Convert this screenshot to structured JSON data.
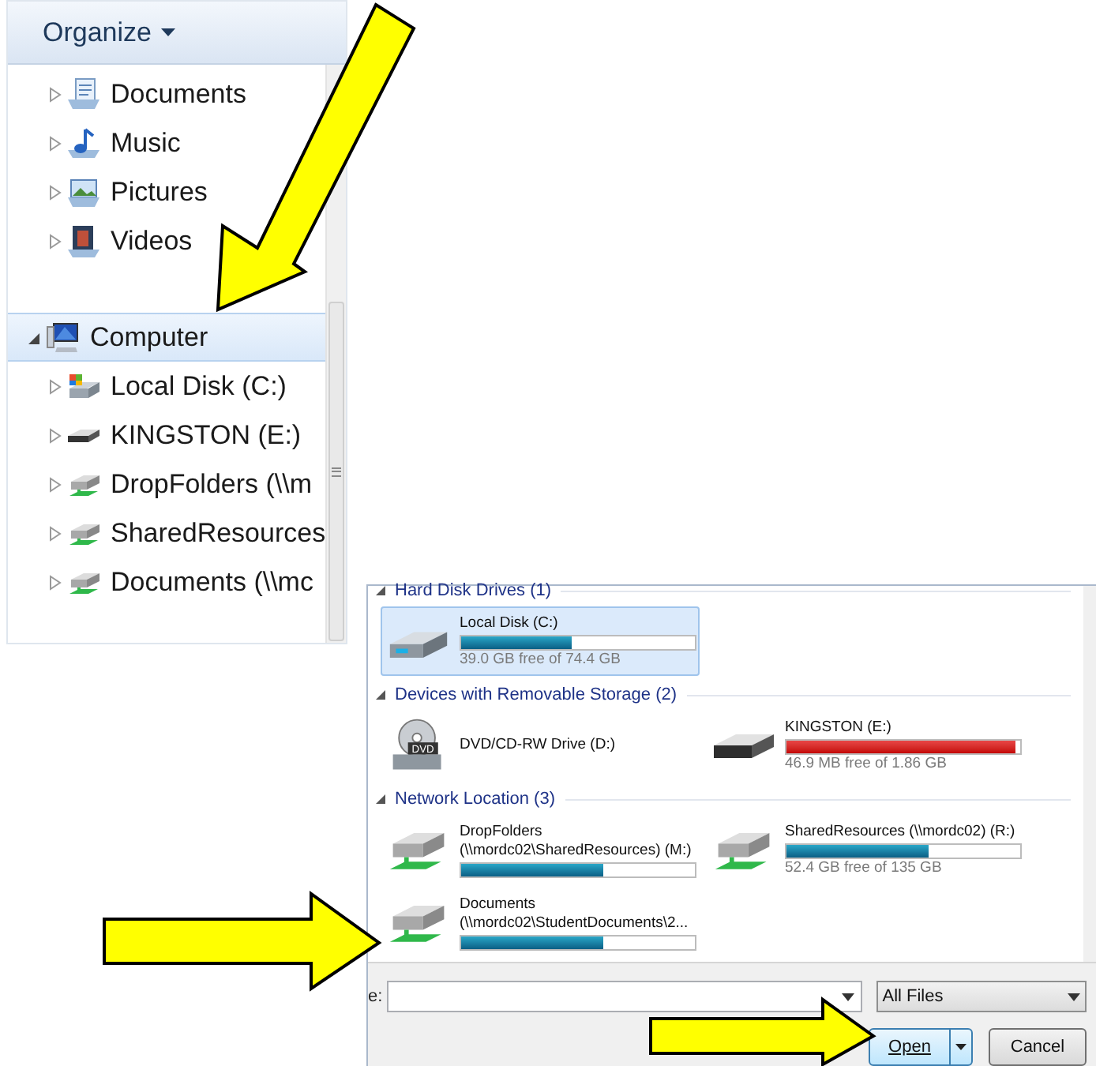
{
  "navigation_pane": {
    "organize_button": "Organize",
    "tree": [
      {
        "label": "Documents",
        "kind": "documents",
        "expanded": false,
        "selected": false
      },
      {
        "label": "Music",
        "kind": "music",
        "expanded": false,
        "selected": false
      },
      {
        "label": "Pictures",
        "kind": "pictures",
        "expanded": false,
        "selected": false
      },
      {
        "label": "Videos",
        "kind": "videos",
        "expanded": false,
        "selected": false
      },
      {
        "label": "Computer",
        "kind": "computer",
        "expanded": true,
        "selected": true,
        "children": [
          {
            "label": "Local Disk (C:)",
            "kind": "system-disk",
            "expanded": false,
            "selected": false
          },
          {
            "label": "KINGSTON (E:)",
            "kind": "usb",
            "expanded": false,
            "selected": false
          },
          {
            "label": "DropFolders (\\\\m",
            "kind": "network",
            "expanded": false,
            "selected": false
          },
          {
            "label": "SharedResources",
            "kind": "network",
            "expanded": false,
            "selected": false
          },
          {
            "label": "Documents (\\\\mc",
            "kind": "network",
            "expanded": false,
            "selected": false
          }
        ]
      }
    ]
  },
  "open_dialog": {
    "sections": [
      {
        "title": "Hard Disk Drives (1)",
        "expanded": true,
        "items": [
          {
            "kind": "hdd",
            "name": "Local Disk (C:)",
            "level": 0.47,
            "free": "39.0 GB free of 74.4 GB",
            "selected": true
          }
        ]
      },
      {
        "title": "Devices with Removable Storage (2)",
        "expanded": true,
        "items": [
          {
            "kind": "dvd",
            "icon_label": "DVD",
            "name": "DVD/CD-RW Drive (D:)",
            "selected": false
          },
          {
            "kind": "usb",
            "name": "KINGSTON (E:)",
            "level": 0.98,
            "free": "46.9 MB free of 1.86 GB",
            "selected": false
          }
        ]
      },
      {
        "title": "Network Location (3)",
        "expanded": true,
        "items": [
          {
            "kind": "network",
            "name": "DropFolders",
            "path": "(\\\\mordc02\\SharedResources) (M:)",
            "level": 0.61,
            "selected": false
          },
          {
            "kind": "network",
            "name": "SharedResources (\\\\mordc02) (R:)",
            "level": 0.61,
            "free": "52.4 GB free of 135 GB",
            "selected": false
          },
          {
            "kind": "network",
            "name": "Documents",
            "path": "(\\\\mordc02\\StudentDocuments\\2...",
            "level": 0.61,
            "selected": false
          }
        ]
      }
    ],
    "file_name_label": "e:",
    "file_type": "All Files",
    "open_button": "Open",
    "cancel_button": "Cancel"
  }
}
